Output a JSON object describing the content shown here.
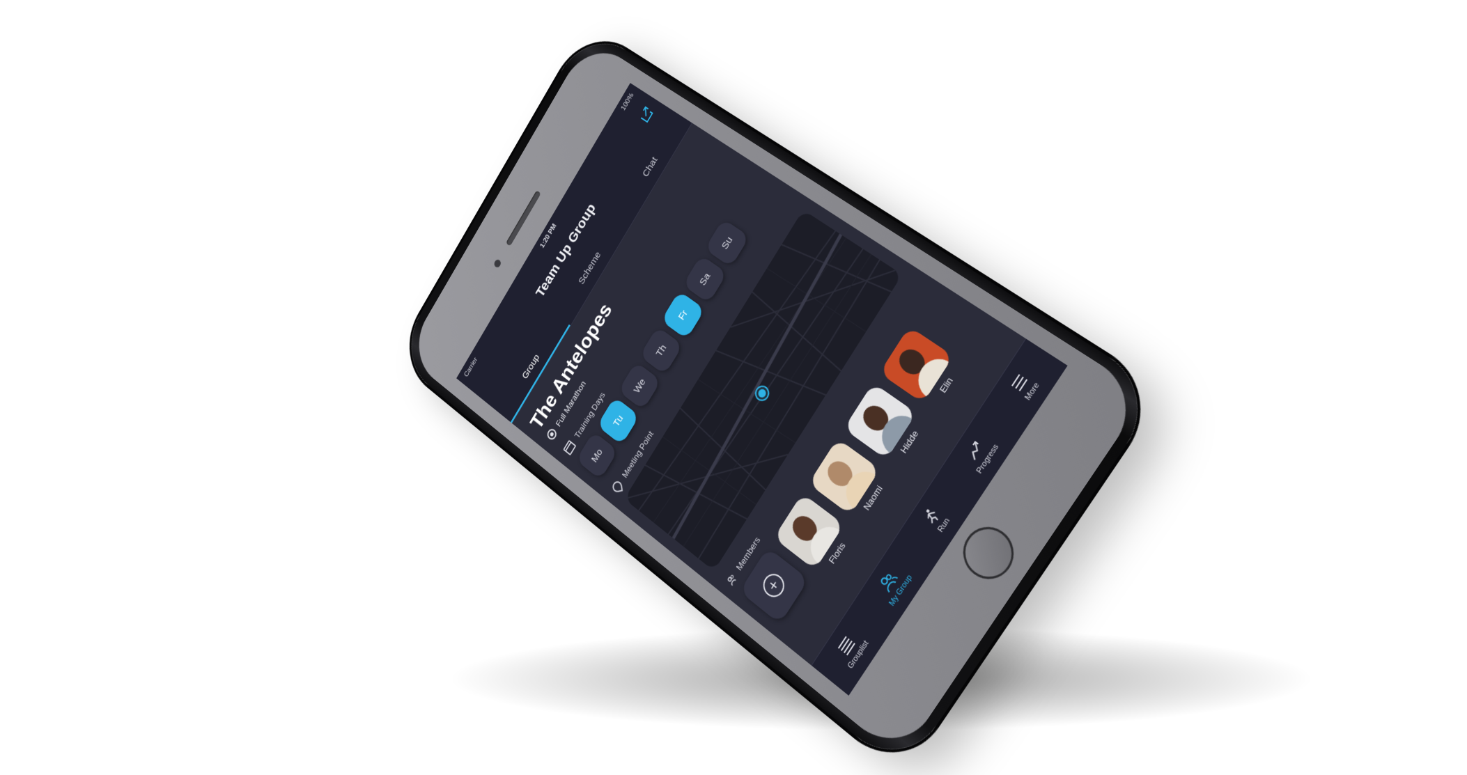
{
  "status": {
    "carrier": "Carrier",
    "time": "1:20 PM",
    "battery": "100%"
  },
  "header": {
    "title": "Team Up Group",
    "share_icon": "share-icon"
  },
  "tabs": [
    {
      "label": "Group",
      "active": true
    },
    {
      "label": "Scheme",
      "active": false
    },
    {
      "label": "Chat",
      "active": false
    }
  ],
  "group": {
    "name": "The Antelopes",
    "type": "Full Marathon"
  },
  "training": {
    "label": "Training Days",
    "days": [
      {
        "label": "Mo",
        "active": false
      },
      {
        "label": "Tu",
        "active": true
      },
      {
        "label": "We",
        "active": false
      },
      {
        "label": "Th",
        "active": false
      },
      {
        "label": "Fr",
        "active": true
      },
      {
        "label": "Sa",
        "active": false
      },
      {
        "label": "Su",
        "active": false
      }
    ]
  },
  "meeting": {
    "label": "Meeting Point"
  },
  "members": {
    "label": "Members",
    "add_icon": "plus-icon",
    "list": [
      {
        "name": "Floris"
      },
      {
        "name": "Naomi"
      },
      {
        "name": "Hidde"
      },
      {
        "name": "Elin"
      }
    ]
  },
  "tabbar": [
    {
      "label": "Grouplist",
      "icon": "list-icon",
      "active": false
    },
    {
      "label": "My Group",
      "icon": "group-icon",
      "active": true
    },
    {
      "label": "Run",
      "icon": "runner-icon",
      "active": false
    },
    {
      "label": "Progress",
      "icon": "progress-icon",
      "active": false
    },
    {
      "label": "More",
      "icon": "menu-icon",
      "active": false
    }
  ],
  "colors": {
    "accent": "#2fb3e6",
    "background": "#2b2c3a",
    "surface": "#343547"
  }
}
